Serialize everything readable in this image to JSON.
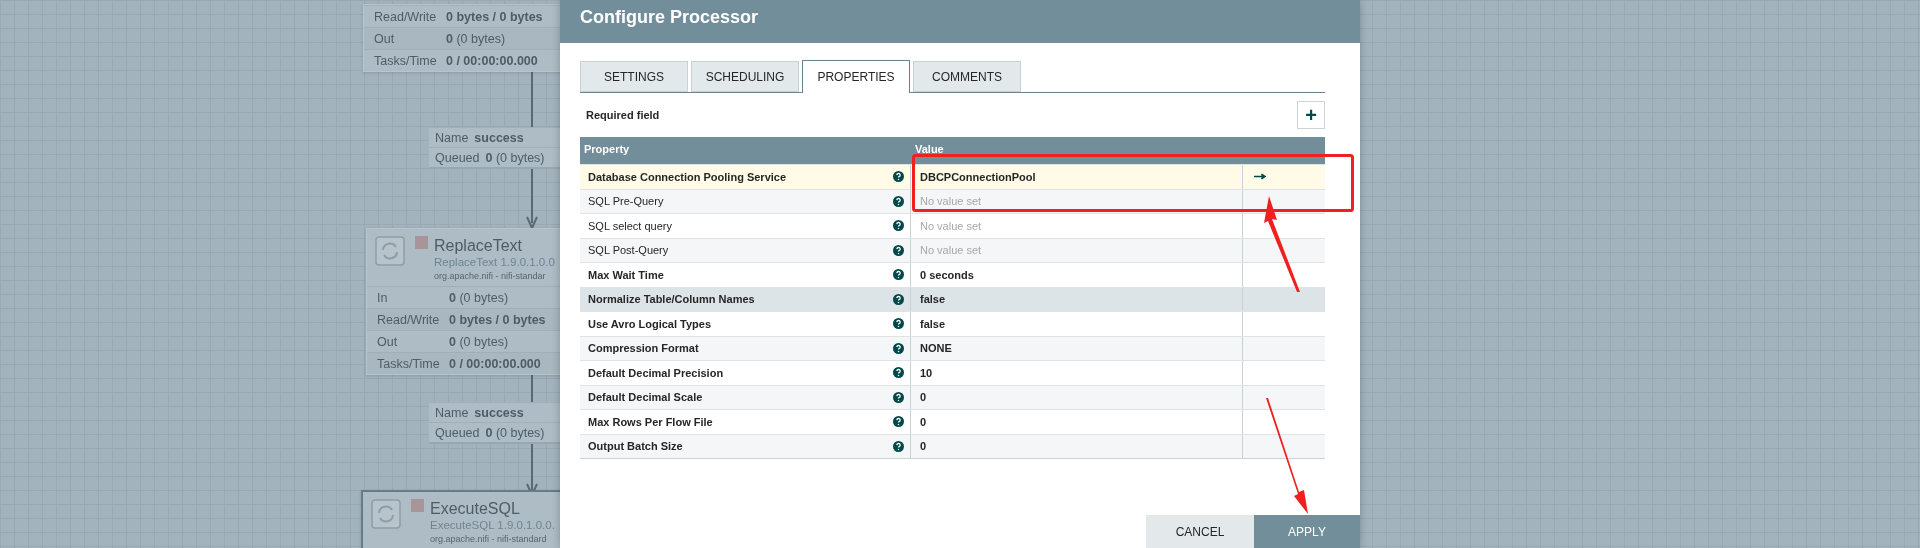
{
  "canvas": {
    "processors": [
      {
        "stats": [
          {
            "label": "Read/Write",
            "value": "**0 bytes / 0 bytes**"
          },
          {
            "label": "Out",
            "value": "**0** (0 bytes)"
          },
          {
            "label": "Tasks/Time",
            "value": "**0 / 00:00:00.000**"
          }
        ]
      },
      {
        "name": "ReplaceText",
        "version": "ReplaceText 1.9.0.1.0.0",
        "bundle": "org.apache.nifi - nifi-standar",
        "stats": [
          {
            "label": "In",
            "value": "**0** (0 bytes)"
          },
          {
            "label": "Read/Write",
            "value": "**0 bytes / 0 bytes**"
          },
          {
            "label": "Out",
            "value": "**0** (0 bytes)"
          },
          {
            "label": "Tasks/Time",
            "value": "**0 / 00:00:00.000**"
          }
        ]
      },
      {
        "name": "ExecuteSQL",
        "version": "ExecuteSQL 1.9.0.1.0.0.",
        "bundle": "org.apache.nifi - nifi-standard"
      }
    ],
    "connections": [
      {
        "name_label": "Name",
        "name": "success",
        "queued_label": "Queued",
        "queued": "**0** (0 bytes)"
      },
      {
        "name_label": "Name",
        "name": "success",
        "queued_label": "Queued",
        "queued": "**0** (0 bytes)"
      }
    ]
  },
  "dialog": {
    "title": "Configure Processor",
    "tabs": [
      {
        "label": "SETTINGS",
        "selected": false
      },
      {
        "label": "SCHEDULING",
        "selected": false
      },
      {
        "label": "PROPERTIES",
        "selected": true
      },
      {
        "label": "COMMENTS",
        "selected": false
      }
    ],
    "required_note": "Required field",
    "add_button": "+",
    "table": {
      "columns": [
        "Property",
        "Value"
      ],
      "rows": [
        {
          "property": "Database Connection Pooling Service",
          "required": true,
          "value": "DBCPConnectionPool",
          "empty": false,
          "selected": true,
          "hovered": false,
          "link": true
        },
        {
          "property": "SQL Pre-Query",
          "required": false,
          "value": "No value set",
          "empty": true,
          "selected": false,
          "hovered": false,
          "link": false
        },
        {
          "property": "SQL select query",
          "required": false,
          "value": "No value set",
          "empty": true,
          "selected": false,
          "hovered": false,
          "link": false
        },
        {
          "property": "SQL Post-Query",
          "required": false,
          "value": "No value set",
          "empty": true,
          "selected": false,
          "hovered": false,
          "link": false
        },
        {
          "property": "Max Wait Time",
          "required": true,
          "value": "0 seconds",
          "empty": false,
          "selected": false,
          "hovered": false,
          "link": false
        },
        {
          "property": "Normalize Table/Column Names",
          "required": true,
          "value": "false",
          "empty": false,
          "selected": false,
          "hovered": true,
          "link": false
        },
        {
          "property": "Use Avro Logical Types",
          "required": true,
          "value": "false",
          "empty": false,
          "selected": false,
          "hovered": false,
          "link": false
        },
        {
          "property": "Compression Format",
          "required": true,
          "value": "NONE",
          "empty": false,
          "selected": false,
          "hovered": false,
          "link": false
        },
        {
          "property": "Default Decimal Precision",
          "required": true,
          "value": "10",
          "empty": false,
          "selected": false,
          "hovered": false,
          "link": false
        },
        {
          "property": "Default Decimal Scale",
          "required": true,
          "value": "0",
          "empty": false,
          "selected": false,
          "hovered": false,
          "link": false
        },
        {
          "property": "Max Rows Per Flow File",
          "required": true,
          "value": "0",
          "empty": false,
          "selected": false,
          "hovered": false,
          "link": false
        },
        {
          "property": "Output Batch Size",
          "required": true,
          "value": "0",
          "empty": false,
          "selected": false,
          "hovered": false,
          "link": false
        }
      ]
    },
    "buttons": [
      {
        "label": "CANCEL",
        "kind": "secondary"
      },
      {
        "label": "APPLY",
        "kind": "primary"
      }
    ]
  }
}
